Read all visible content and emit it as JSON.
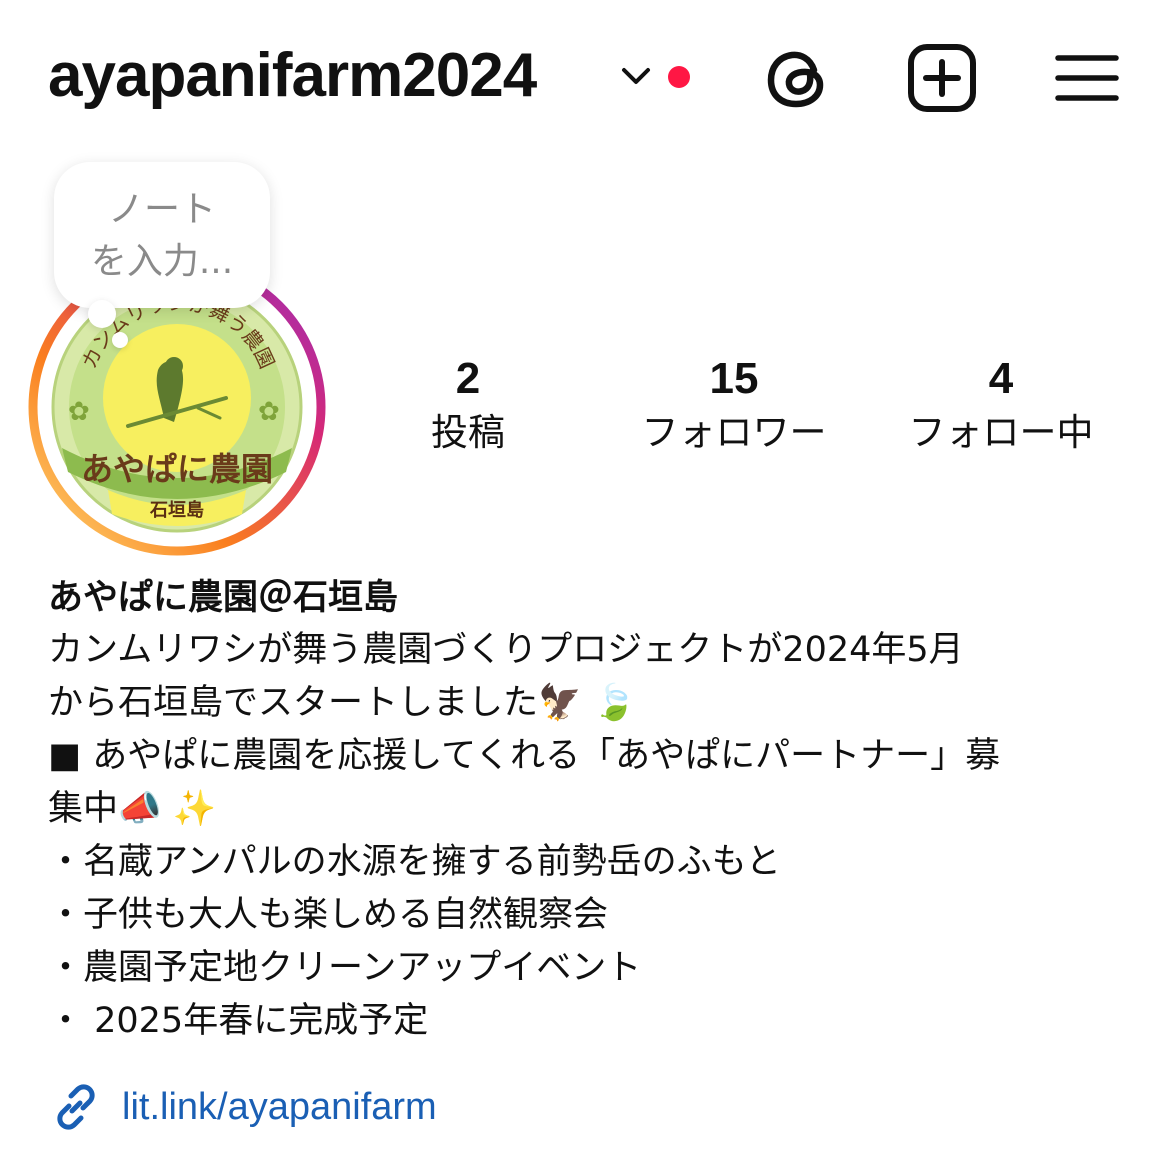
{
  "header": {
    "username": "ayapanifarm2024",
    "colors": {
      "notification_dot": "#ff1744",
      "text": "#111111"
    },
    "icons": [
      "chevron-down-icon",
      "threads-icon",
      "new-post-icon",
      "menu-icon"
    ]
  },
  "note": {
    "line1": "ノート",
    "line2": "を入力..."
  },
  "avatar": {
    "ring_colors": [
      "#feda75",
      "#fa7e1e",
      "#d62976",
      "#962fbf"
    ],
    "logo_arc_text": "カンムリワシが舞う農園",
    "logo_name": "あやぱに農園",
    "logo_place": "石垣島"
  },
  "stats": {
    "posts": {
      "count": "2",
      "label": "投稿"
    },
    "followers": {
      "count": "15",
      "label": "フォロワー"
    },
    "following": {
      "count": "4",
      "label": "フォロー中"
    }
  },
  "bio": {
    "display_name": "あやぱに農園＠石垣島",
    "lines": [
      "カンムリワシが舞う農園づくりプロジェクトが2024年5月",
      "から石垣島でスタートしました🦅 🍃",
      "■ あやぱに農園を応援してくれる「あやぱにパートナー」募",
      "集中📣 ✨",
      "・名蔵アンパルの水源を擁する前勢岳のふもと",
      "・子供も大人も楽しめる自然観察会",
      "・農園予定地クリーンアップイベント",
      "・ 2025年春に完成予定"
    ],
    "link": "lit.link/ayapanifarm",
    "link_color": "#1a5fb4"
  }
}
